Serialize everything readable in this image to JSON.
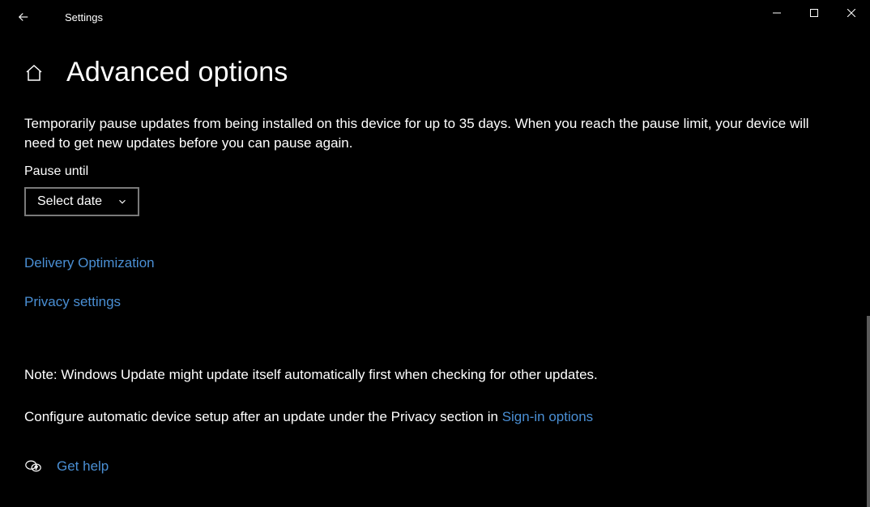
{
  "titlebar": {
    "app_title": "Settings"
  },
  "header": {
    "page_title": "Advanced options"
  },
  "main": {
    "description": "Temporarily pause updates from being installed on this device for up to 35 days. When you reach the pause limit, your device will need to get new updates before you can pause again.",
    "pause_label": "Pause until",
    "select_placeholder": "Select date",
    "delivery_link": "Delivery Optimization",
    "privacy_link": "Privacy settings",
    "note": "Note: Windows Update might update itself automatically first when checking for other updates.",
    "configure_prefix": "Configure automatic device setup after an update under the Privacy section in ",
    "signin_link": "Sign-in options",
    "help_link": "Get help"
  },
  "colors": {
    "link": "#4a8fd4",
    "background": "#000000"
  }
}
